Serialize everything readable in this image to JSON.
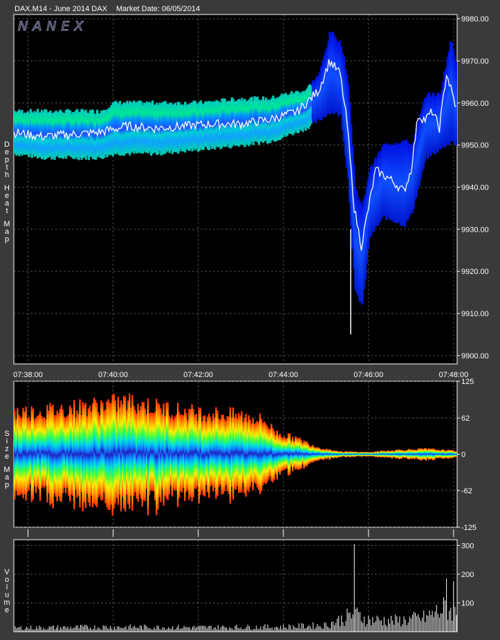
{
  "header": {
    "symbol": "DAX.M14 - June 2014 DAX",
    "market_date": "Market Date: 06/05/2014"
  },
  "logo": "NANEX",
  "panels": {
    "depth": {
      "label": "Depth Heat Map"
    },
    "size": {
      "label": "Size Map"
    },
    "volume": {
      "label": "Volume"
    }
  },
  "colors": {
    "background": "#3a3a3a",
    "plot_background": "#000000",
    "price_line": "#ffffff",
    "heat_low": "#0022ee",
    "heat_mid": "#00e0c0",
    "heat_high": "#40ff40",
    "size_center": "#2020d0",
    "size_outer": "#ff2000"
  },
  "chart_data": [
    {
      "type": "heatmap",
      "name": "Depth Heat Map",
      "x_ticks": [
        "07:38:00",
        "07:40:00",
        "07:42:00",
        "07:44:00",
        "07:46:00",
        "07:48:00"
      ],
      "x_range": [
        "07:37:40",
        "07:48:05"
      ],
      "y_ticks": [
        "9980.00",
        "9970.00",
        "9960.00",
        "9950.00",
        "9940.00",
        "9930.00",
        "9920.00",
        "9910.00",
        "9900.00"
      ],
      "ylim": [
        9898,
        9981
      ],
      "grid": true,
      "price_path": [
        [
          "07:37:40",
          9953
        ],
        [
          "07:38:20",
          9952
        ],
        [
          "07:39:00",
          9952.5
        ],
        [
          "07:39:40",
          9953
        ],
        [
          "07:40:20",
          9954.5
        ],
        [
          "07:41:00",
          9954
        ],
        [
          "07:41:40",
          9954.5
        ],
        [
          "07:42:20",
          9955
        ],
        [
          "07:43:00",
          9955
        ],
        [
          "07:43:40",
          9956
        ],
        [
          "07:44:20",
          9958
        ],
        [
          "07:44:50",
          9963
        ],
        [
          "07:45:05",
          9970
        ],
        [
          "07:45:20",
          9967
        ],
        [
          "07:45:30",
          9955
        ],
        [
          "07:45:40",
          9935
        ],
        [
          "07:45:50",
          9926
        ],
        [
          "07:46:00",
          9935
        ],
        [
          "07:46:10",
          9944
        ],
        [
          "07:46:30",
          9942
        ],
        [
          "07:46:50",
          9939
        ],
        [
          "07:47:00",
          9944
        ],
        [
          "07:47:10",
          9957
        ],
        [
          "07:47:20",
          9956
        ],
        [
          "07:47:30",
          9958
        ],
        [
          "07:47:40",
          9954
        ],
        [
          "07:47:50",
          9967
        ],
        [
          "07:48:05",
          9958
        ]
      ],
      "book_band": [
        [
          "07:37:40",
          9948,
          9958
        ],
        [
          "07:38:20",
          9947,
          9958
        ],
        [
          "07:39:00",
          9947,
          9958
        ],
        [
          "07:39:40",
          9947,
          9958
        ],
        [
          "07:40:00",
          9948,
          9960
        ],
        [
          "07:41:00",
          9948,
          9960
        ],
        [
          "07:42:00",
          9949,
          9960
        ],
        [
          "07:43:00",
          9950,
          9961
        ],
        [
          "07:43:40",
          9951,
          9961
        ],
        [
          "07:44:00",
          9952,
          9962
        ],
        [
          "07:44:30",
          9954,
          9963
        ],
        [
          "07:44:50",
          9956,
          9967
        ],
        [
          "07:45:05",
          9958,
          9977
        ],
        [
          "07:45:20",
          9957,
          9974
        ],
        [
          "07:45:30",
          9942,
          9965
        ],
        [
          "07:45:40",
          9915,
          9940
        ],
        [
          "07:45:50",
          9912,
          9935
        ],
        [
          "07:46:00",
          9928,
          9944
        ],
        [
          "07:46:20",
          9933,
          9950
        ],
        [
          "07:46:50",
          9931,
          9951
        ],
        [
          "07:47:00",
          9934,
          9950
        ],
        [
          "07:47:20",
          9947,
          9962
        ],
        [
          "07:47:40",
          9949,
          9962
        ],
        [
          "07:47:55",
          9951,
          9975
        ],
        [
          "07:48:05",
          9950,
          9968
        ]
      ],
      "low_spike": [
        "07:45:35",
        9905
      ]
    },
    {
      "type": "area",
      "name": "Size Map",
      "y_ticks": [
        "125",
        "62",
        "0",
        "-62",
        "-125"
      ],
      "ylim": [
        -125,
        125
      ],
      "grid": true,
      "envelope": [
        [
          "07:37:40",
          78
        ],
        [
          "07:38:20",
          80
        ],
        [
          "07:39:00",
          86
        ],
        [
          "07:39:40",
          92
        ],
        [
          "07:40:20",
          98
        ],
        [
          "07:41:00",
          88
        ],
        [
          "07:41:40",
          80
        ],
        [
          "07:42:20",
          76
        ],
        [
          "07:43:00",
          72
        ],
        [
          "07:43:30",
          64
        ],
        [
          "07:43:50",
          40
        ],
        [
          "07:44:20",
          28
        ],
        [
          "07:44:50",
          12
        ],
        [
          "07:45:20",
          5
        ],
        [
          "07:46:00",
          4
        ],
        [
          "07:46:40",
          8
        ],
        [
          "07:47:20",
          10
        ],
        [
          "07:48:05",
          6
        ]
      ]
    },
    {
      "type": "bar",
      "name": "Volume",
      "y_ticks": [
        "300",
        "200",
        "100"
      ],
      "ylim": [
        0,
        320
      ],
      "grid": true,
      "profile": [
        [
          "07:37:40",
          18
        ],
        [
          "07:39:00",
          20
        ],
        [
          "07:40:00",
          22
        ],
        [
          "07:42:00",
          20
        ],
        [
          "07:44:00",
          22
        ],
        [
          "07:45:00",
          30
        ],
        [
          "07:45:40",
          80
        ],
        [
          "07:46:00",
          55
        ],
        [
          "07:46:40",
          50
        ],
        [
          "07:47:20",
          65
        ],
        [
          "07:47:50",
          110
        ],
        [
          "07:48:05",
          90
        ]
      ],
      "spikes": [
        [
          "07:45:40",
          305
        ],
        [
          "07:47:50",
          185
        ],
        [
          "07:48:00",
          175
        ]
      ]
    }
  ]
}
